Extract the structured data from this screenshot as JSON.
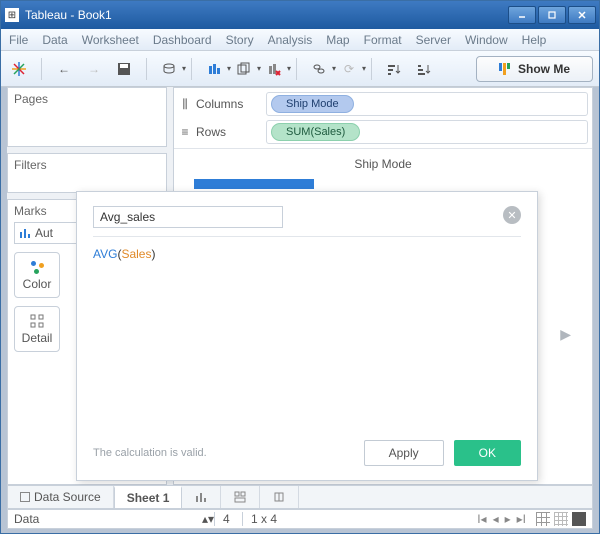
{
  "window": {
    "title": "Tableau - Book1"
  },
  "menu": [
    "File",
    "Data",
    "Worksheet",
    "Dashboard",
    "Story",
    "Analysis",
    "Map",
    "Format",
    "Server",
    "Window",
    "Help"
  ],
  "toolbar": {
    "showme_label": "Show Me"
  },
  "sidebar": {
    "pages_title": "Pages",
    "filters_title": "Filters",
    "marks_title": "Marks",
    "marks_type": "Aut",
    "color_label": "Color",
    "detail_label": "Detail"
  },
  "shelves": {
    "columns_label": "Columns",
    "rows_label": "Rows",
    "columns_pill": "Ship Mode",
    "rows_pill": "SUM(Sales)"
  },
  "viz": {
    "header": "Ship Mode"
  },
  "calc_editor": {
    "name": "Avg_sales",
    "formula_fn": "AVG",
    "formula_field": "Sales",
    "valid_msg": "The calculation is valid.",
    "apply_label": "Apply",
    "ok_label": "OK"
  },
  "tabs": {
    "data_source": "Data Source",
    "sheet1": "Sheet 1"
  },
  "status": {
    "field": "Data",
    "marks": "4",
    "dims": "1 x 4"
  }
}
